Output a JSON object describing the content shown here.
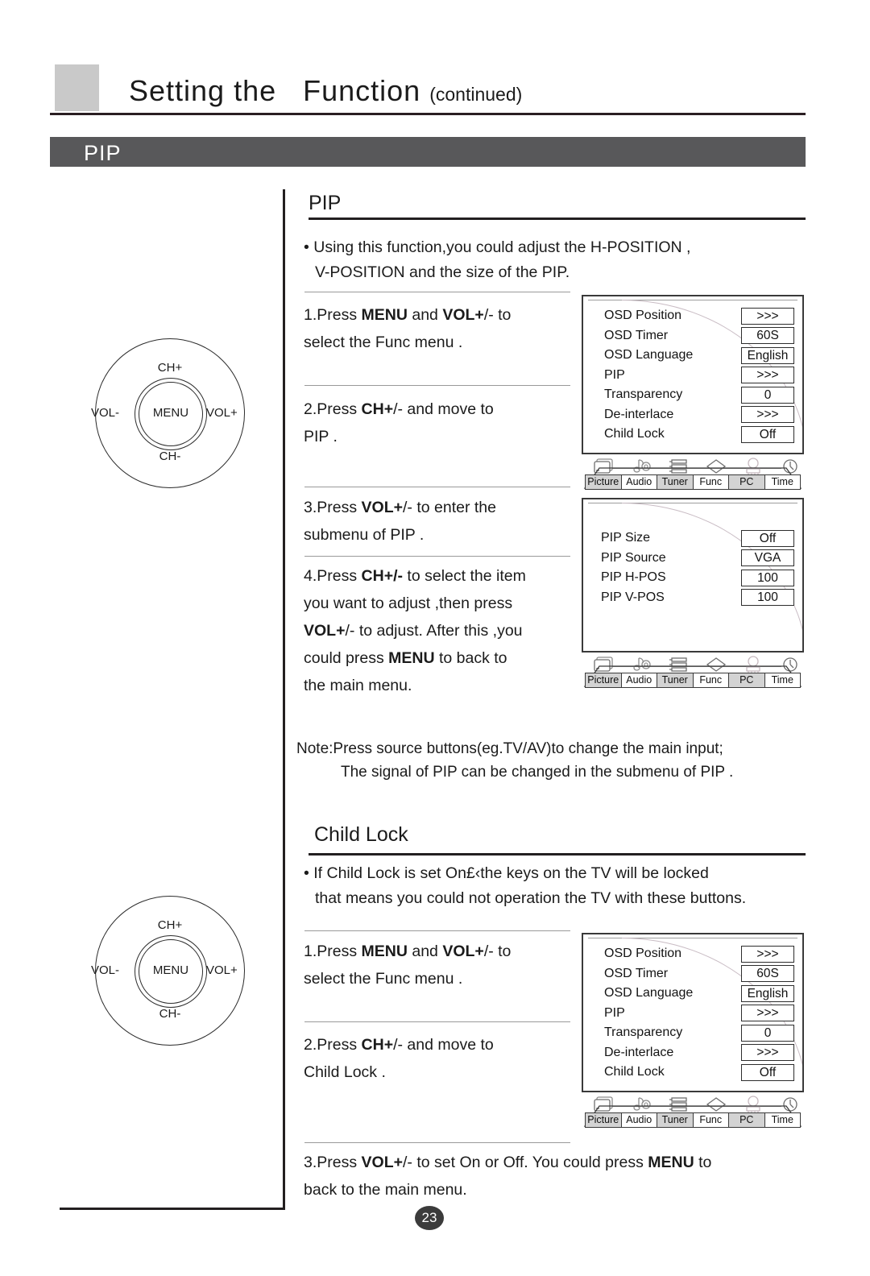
{
  "header": {
    "title_main": "Setting the   Function",
    "title_cont": "(continued)",
    "banner_label": "PIP"
  },
  "remote": {
    "ch_up": "CH+",
    "ch_down": "CH-",
    "vol_down": "VOL-",
    "vol_up": "VOL+",
    "menu": "MENU"
  },
  "pip_section": {
    "heading": "PIP",
    "bullet_line1": "Using this function,you could adjust the H-POSITION ,",
    "bullet_line2": "V-POSITION and the size of the PIP.",
    "steps": [
      {
        "id": "step1",
        "prefix": "1.Press ",
        "b1": "MENU",
        "mid1": " and ",
        "b2": "VOL+",
        "mid2": "/- to",
        "rest": "select the Func menu ."
      },
      {
        "id": "step2",
        "prefix": "2.Press ",
        "b1": "CH+",
        "mid1": "/- and move to",
        "rest": "PIP ."
      },
      {
        "id": "step3",
        "prefix": "3.Press ",
        "b1": "VOL+",
        "mid1": "/- to enter the",
        "rest": "submenu of PIP ."
      }
    ],
    "step4": {
      "l1a": "4.Press ",
      "l1b": "CH+/-",
      "l1c": " to select the item",
      "l2": "you want to adjust ,then press",
      "l3a": "VOL+",
      "l3b": "/- to adjust. After this ,you",
      "l4a": "could press ",
      "l4b": "MENU",
      "l4c": " to back to",
      "l5": "the main menu."
    }
  },
  "note": {
    "line1": "Note:Press source buttons(eg.TV/AV)to change the main input;",
    "line2": "The signal of PIP can be changed in the submenu of PIP ."
  },
  "child_lock_section": {
    "heading": "Child Lock",
    "bullet_line1": "If Child Lock is set On£‹the keys on the TV will be locked",
    "bullet_line2": "that  means you could not operation the TV with these buttons.",
    "steps": [
      {
        "id": "cl-step1",
        "prefix": "1.Press ",
        "b1": "MENU",
        "mid1": " and ",
        "b2": "VOL+",
        "mid2": "/- to",
        "rest": "select the Func menu ."
      },
      {
        "id": "cl-step2",
        "prefix": "2.Press ",
        "b1": "CH+",
        "mid1": "/- and move to",
        "rest": "Child Lock ."
      }
    ],
    "step3": {
      "l1a": "3.Press ",
      "l1b": "VOL+",
      "l1c": "/- to set On or Off. You could press ",
      "l1d": "MENU",
      "l1e": " to",
      "l2": "back to the main menu."
    }
  },
  "osd_func_menu": {
    "rows": [
      {
        "label": "OSD Position",
        "value": ">>>"
      },
      {
        "label": "OSD Timer",
        "value": "60S"
      },
      {
        "label": "OSD Language",
        "value": "English"
      },
      {
        "label": "PIP",
        "value": ">>>"
      },
      {
        "label": "Transparency",
        "value": "0"
      },
      {
        "label": "De-interlace",
        "value": ">>>"
      },
      {
        "label": "Child Lock",
        "value": "Off"
      }
    ],
    "tabs": [
      {
        "label": "Picture",
        "icon": "monitor-icon",
        "shaded": true
      },
      {
        "label": "Audio",
        "icon": "music-note-icon",
        "shaded": false
      },
      {
        "label": "Tuner",
        "icon": "tuner-bars-icon",
        "shaded": true
      },
      {
        "label": "Func",
        "icon": "diamond-icon",
        "shaded": false
      },
      {
        "label": "PC",
        "icon": "computer-icon",
        "shaded": true
      },
      {
        "label": "Time",
        "icon": "clock-icon",
        "shaded": false
      }
    ]
  },
  "osd_pip_submenu": {
    "rows": [
      {
        "label": "PIP Size",
        "value": "Off"
      },
      {
        "label": "PIP Source",
        "value": "VGA"
      },
      {
        "label": "PIP H-POS",
        "value": "100"
      },
      {
        "label": "PIP V-POS",
        "value": "100"
      }
    ],
    "tabs": [
      {
        "label": "Picture",
        "icon": "monitor-icon",
        "shaded": true
      },
      {
        "label": "Audio",
        "icon": "music-note-icon",
        "shaded": false
      },
      {
        "label": "Tuner",
        "icon": "tuner-bars-icon",
        "shaded": true
      },
      {
        "label": "Func",
        "icon": "diamond-icon",
        "shaded": false
      },
      {
        "label": "PC",
        "icon": "computer-icon",
        "shaded": true
      },
      {
        "label": "Time",
        "icon": "clock-icon",
        "shaded": false
      }
    ]
  },
  "page_number": "23"
}
